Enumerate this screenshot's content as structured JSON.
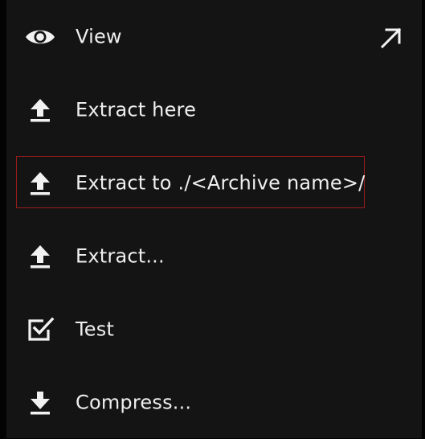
{
  "menu": {
    "items": [
      {
        "label": "View",
        "icon": "eye-icon"
      },
      {
        "label": "Extract here",
        "icon": "extract-icon"
      },
      {
        "label": "Extract to ./<Archive name>/",
        "icon": "extract-icon"
      },
      {
        "label": "Extract...",
        "icon": "extract-icon"
      },
      {
        "label": "Test",
        "icon": "checkbox-icon"
      },
      {
        "label": "Compress...",
        "icon": "compress-icon"
      }
    ],
    "open_external_icon": "open-external-icon",
    "focused_index": 2
  },
  "colors": {
    "menu_bg": "#141414",
    "text": "#efefef",
    "focus_ring": "#9b1c1c"
  }
}
